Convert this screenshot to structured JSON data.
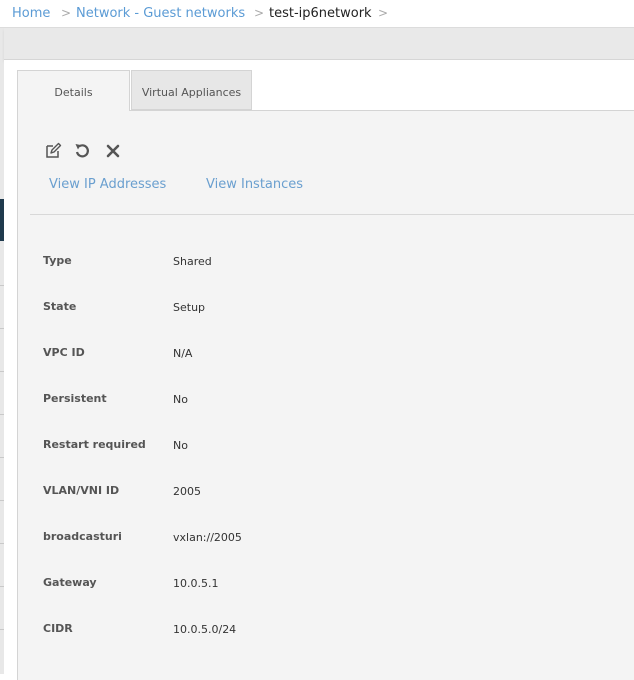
{
  "breadcrumb": {
    "items": [
      "Home",
      "Network - Guest networks",
      "test-ip6network"
    ],
    "separator": ">"
  },
  "tabs": {
    "details": "Details",
    "virtual_appliances": "Virtual Appliances"
  },
  "actions": {
    "icons": [
      "edit-icon",
      "restart-icon",
      "delete-icon"
    ]
  },
  "links": {
    "view_ip_addresses": "View IP Addresses",
    "view_instances": "View Instances"
  },
  "details": [
    {
      "label": "Type",
      "value": "Shared"
    },
    {
      "label": "State",
      "value": "Setup"
    },
    {
      "label": "VPC ID",
      "value": "N/A"
    },
    {
      "label": "Persistent",
      "value": "No"
    },
    {
      "label": "Restart required",
      "value": "No"
    },
    {
      "label": "VLAN/VNI ID",
      "value": "2005"
    },
    {
      "label": "broadcasturi",
      "value": "vxlan://2005"
    },
    {
      "label": "Gateway",
      "value": "10.0.5.1"
    },
    {
      "label": "CIDR",
      "value": "10.0.5.0/24"
    }
  ],
  "colors": {
    "link": "#5b9bd5",
    "panel_bg": "#f4f4f4",
    "sidebar_active": "#1f3a4d"
  }
}
